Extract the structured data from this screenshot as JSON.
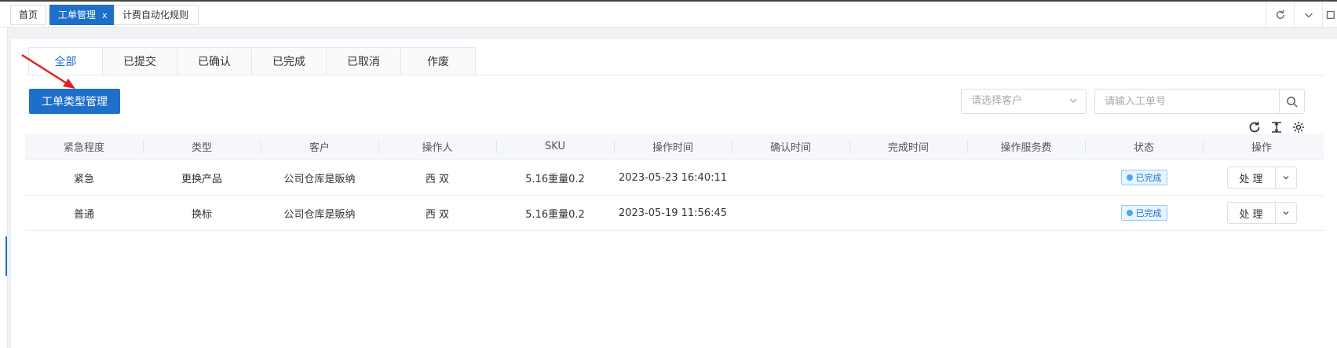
{
  "page_tabs": [
    {
      "label": "首页"
    },
    {
      "label": "工单管理",
      "close": "x"
    },
    {
      "label": "计费自动化规则"
    }
  ],
  "status_tabs": [
    "全部",
    "已提交",
    "已确认",
    "已完成",
    "已取消",
    "作废"
  ],
  "toolbar": {
    "type_manage_label": "工单类型管理",
    "customer_placeholder": "请选择客户",
    "order_placeholder": "请输入工单号"
  },
  "table": {
    "columns": [
      "紧急程度",
      "类型",
      "客户",
      "操作人",
      "SKU",
      "操作时间",
      "确认时间",
      "完成时间",
      "操作服务费",
      "状态",
      "操作"
    ],
    "rows": [
      {
        "urgency": "紧急",
        "type": "更换产品",
        "customer": "公司仓库是販纳",
        "operator": "西 双",
        "sku": "5.16重量0.2",
        "op_time": "2023-05-23 16:40:11",
        "confirm_time": "",
        "finish_time": "",
        "fee": "",
        "status": "已完成",
        "action": "处 理"
      },
      {
        "urgency": "普通",
        "type": "换标",
        "customer": "公司仓库是販纳",
        "operator": "西 双",
        "sku": "5.16重量0.2",
        "op_time": "2023-05-19 11:56:45",
        "confirm_time": "",
        "finish_time": "",
        "fee": "",
        "status": "已完成",
        "action": "处 理"
      }
    ]
  },
  "colors": {
    "accent": "#1e6fc9",
    "annotation_arrow": "#e02020"
  }
}
